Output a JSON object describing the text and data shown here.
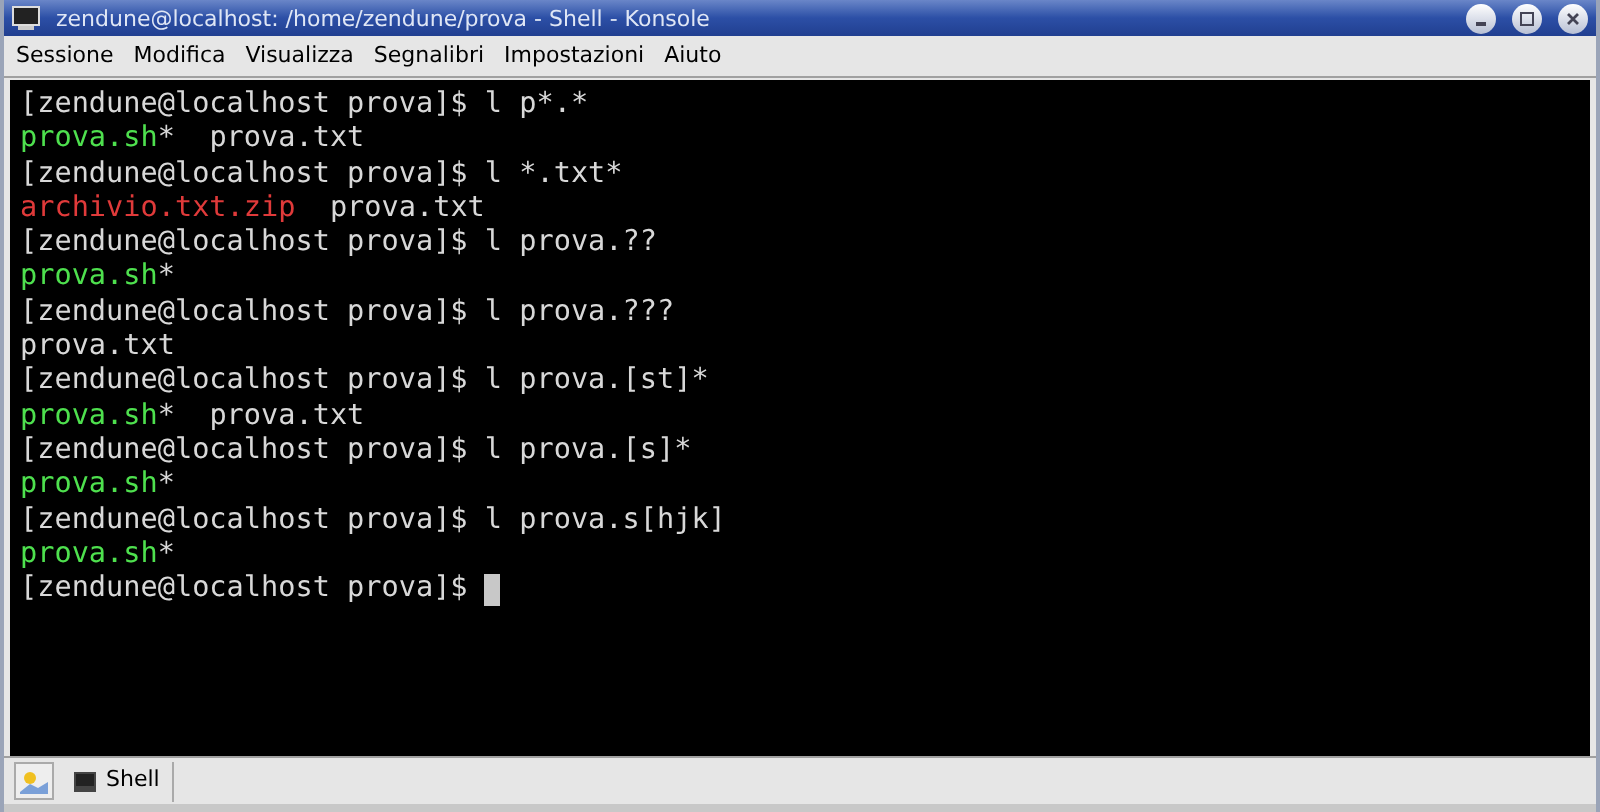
{
  "window": {
    "title": "zendune@localhost: /home/zendune/prova - Shell - Konsole"
  },
  "menu": [
    "Sessione",
    "Modifica",
    "Visualizza",
    "Segnalibri",
    "Impostazioni",
    "Aiuto"
  ],
  "terminal": {
    "lines": [
      [
        {
          "text": "[zendune@localhost prova]$ l p*.*",
          "kind": "plain"
        }
      ],
      [
        {
          "text": "prova.sh",
          "kind": "executable"
        },
        {
          "text": "*  prova.txt",
          "kind": "plain"
        }
      ],
      [
        {
          "text": "[zendune@localhost prova]$ l *.txt*",
          "kind": "plain"
        }
      ],
      [
        {
          "text": "archivio.txt.zip",
          "kind": "archive"
        },
        {
          "text": "  prova.txt",
          "kind": "plain"
        }
      ],
      [
        {
          "text": "[zendune@localhost prova]$ l prova.??",
          "kind": "plain"
        }
      ],
      [
        {
          "text": "prova.sh",
          "kind": "executable"
        },
        {
          "text": "*",
          "kind": "plain"
        }
      ],
      [
        {
          "text": "[zendune@localhost prova]$ l prova.???",
          "kind": "plain"
        }
      ],
      [
        {
          "text": "prova.txt",
          "kind": "plain"
        }
      ],
      [
        {
          "text": "[zendune@localhost prova]$ l prova.[st]*",
          "kind": "plain"
        }
      ],
      [
        {
          "text": "prova.sh",
          "kind": "executable"
        },
        {
          "text": "*  prova.txt",
          "kind": "plain"
        }
      ],
      [
        {
          "text": "[zendune@localhost prova]$ l prova.[s]*",
          "kind": "plain"
        }
      ],
      [
        {
          "text": "prova.sh",
          "kind": "executable"
        },
        {
          "text": "*",
          "kind": "plain"
        }
      ],
      [
        {
          "text": "[zendune@localhost prova]$ l prova.s[hjk]",
          "kind": "plain"
        }
      ],
      [
        {
          "text": "prova.sh",
          "kind": "executable"
        },
        {
          "text": "*",
          "kind": "plain"
        }
      ],
      [
        {
          "text": "[zendune@localhost prova]$ ",
          "kind": "plain"
        }
      ]
    ],
    "cursor": true
  },
  "tabs": [
    {
      "label": "Shell",
      "selected": true
    }
  ]
}
